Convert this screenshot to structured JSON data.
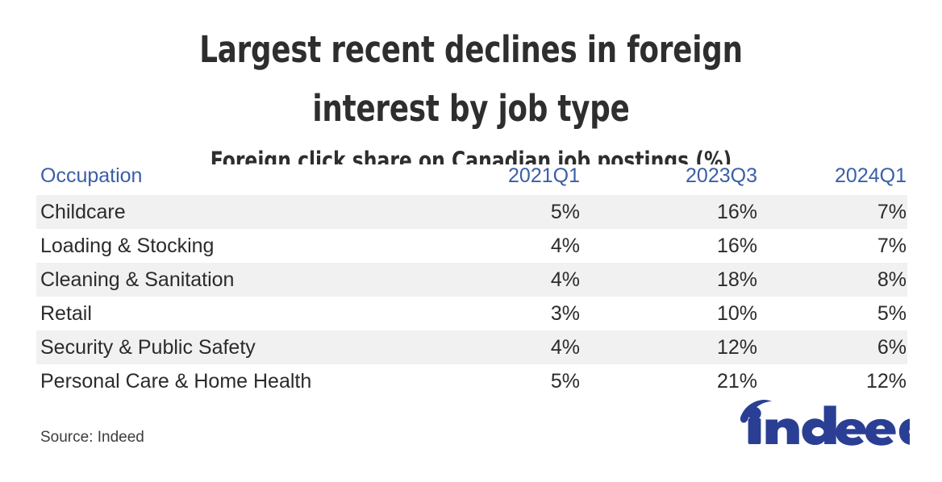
{
  "header": {
    "title": "Largest recent declines in foreign interest by job type",
    "subtitle": "Foreign click share on Canadian job postings (%)"
  },
  "footer": {
    "source": "Source: Indeed",
    "logo_text": "indeed"
  },
  "colors": {
    "header_blue": "#3b5ea8",
    "body_text": "#2b2b2b",
    "title_text": "#2e2e2e",
    "row_shade": "#f1f1f1",
    "background": "#ffffff",
    "logo_blue": "#2a3f94"
  },
  "chart_data": {
    "type": "table",
    "title": "Largest recent declines in foreign interest by job type",
    "subtitle": "Foreign click share on Canadian job postings (%)",
    "columns": [
      "Occupation",
      "2021Q1",
      "2023Q3",
      "2024Q1"
    ],
    "rows": [
      {
        "occupation": "Childcare",
        "q_2021q1": "5%",
        "q_2023q3": "16%",
        "q_2024q1": "7%"
      },
      {
        "occupation": "Loading & Stocking",
        "q_2021q1": "4%",
        "q_2023q3": "16%",
        "q_2024q1": "7%"
      },
      {
        "occupation": "Cleaning & Sanitation",
        "q_2021q1": "4%",
        "q_2023q3": "18%",
        "q_2024q1": "8%"
      },
      {
        "occupation": "Retail",
        "q_2021q1": "3%",
        "q_2023q3": "10%",
        "q_2024q1": "5%"
      },
      {
        "occupation": "Security & Public Safety",
        "q_2021q1": "4%",
        "q_2023q3": "12%",
        "q_2024q1": "6%"
      },
      {
        "occupation": "Personal Care & Home Health",
        "q_2021q1": "5%",
        "q_2023q3": "21%",
        "q_2024q1": "12%"
      }
    ],
    "series": [
      {
        "name": "2021Q1",
        "values": [
          5,
          4,
          4,
          3,
          4,
          5
        ]
      },
      {
        "name": "2023Q3",
        "values": [
          16,
          16,
          18,
          10,
          12,
          21
        ]
      },
      {
        "name": "2024Q1",
        "values": [
          7,
          7,
          8,
          5,
          6,
          12
        ]
      }
    ],
    "categories": [
      "Childcare",
      "Loading & Stocking",
      "Cleaning & Sanitation",
      "Retail",
      "Security & Public Safety",
      "Personal Care & Home Health"
    ],
    "units": "percent",
    "source": "Source: Indeed"
  }
}
